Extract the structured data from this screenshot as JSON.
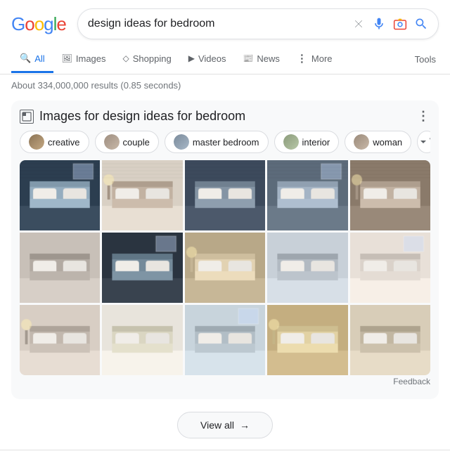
{
  "header": {
    "logo": "Google",
    "search_query": "design ideas for bedroom"
  },
  "nav": {
    "tabs": [
      {
        "id": "all",
        "label": "All",
        "icon": "🔍",
        "active": true
      },
      {
        "id": "images",
        "label": "Images",
        "icon": "🖼"
      },
      {
        "id": "shopping",
        "label": "Shopping",
        "icon": "🛍"
      },
      {
        "id": "videos",
        "label": "Videos",
        "icon": "▶"
      },
      {
        "id": "news",
        "label": "News",
        "icon": "📰"
      },
      {
        "id": "more",
        "label": "More",
        "icon": "⋮"
      }
    ],
    "tools": "Tools"
  },
  "results": {
    "count_text": "About 334,000,000 results (0.85 seconds)"
  },
  "images_section": {
    "title": "Images for design ideas for bedroom",
    "chips": [
      {
        "label": "creative",
        "color": "chip-creative"
      },
      {
        "label": "couple",
        "color": "chip-couple"
      },
      {
        "label": "master bedroom",
        "color": "chip-master"
      },
      {
        "label": "interior",
        "color": "chip-interior"
      },
      {
        "label": "woman",
        "color": "chip-woman"
      }
    ],
    "feedback_label": "Feedback",
    "view_all_label": "View all",
    "view_all_arrow": "→"
  }
}
